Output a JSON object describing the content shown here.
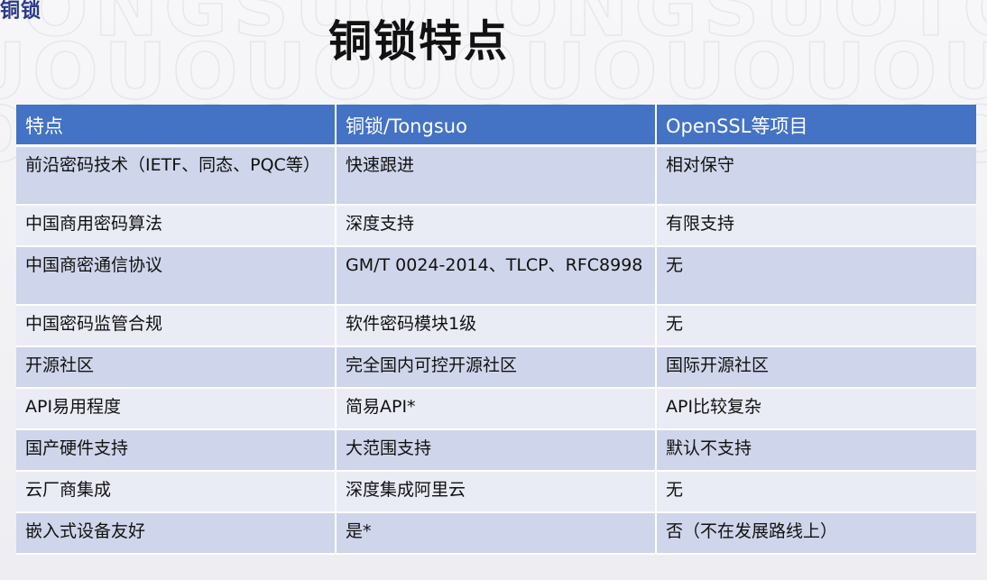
{
  "corner_label": "铜锁",
  "title": "铜锁特点",
  "table": {
    "headers": [
      "特点",
      "铜锁/Tongsuo",
      "OpenSSL等项目"
    ],
    "rows": [
      [
        "前沿密码技术（IETF、同态、PQC等）",
        "快速跟进",
        "相对保守"
      ],
      [
        "中国商用密码算法",
        "深度支持",
        "有限支持"
      ],
      [
        "中国商密通信协议",
        "GM/T 0024-2014、TLCP、RFC8998",
        "无"
      ],
      [
        "中国密码监管合规",
        "软件密码模块1级",
        "无"
      ],
      [
        "开源社区",
        "完全国内可控开源社区",
        "国际开源社区"
      ],
      [
        "API易用程度",
        "简易API*",
        "API比较复杂"
      ],
      [
        "国产硬件支持",
        "大范围支持",
        "默认不支持"
      ],
      [
        "云厂商集成",
        "深度集成阿里云",
        "无"
      ],
      [
        "嵌入式设备友好",
        "是*",
        "否（不在发展路线上）"
      ]
    ]
  },
  "colors": {
    "header_bg": "#4472c4",
    "row_odd": "#cfd5ea",
    "row_even": "#e9ebf5"
  }
}
